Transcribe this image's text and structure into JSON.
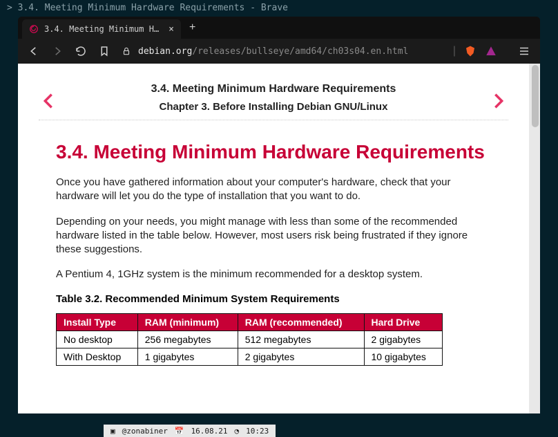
{
  "titlebar": "> 3.4. Meeting Minimum Hardware Requirements - Brave",
  "tab": {
    "title": "3.4. Meeting Minimum Hardw…"
  },
  "url": {
    "host": "debian.org",
    "path": "/releases/bullseye/amd64/ch03s04.en.html"
  },
  "navheader": {
    "section": "3.4. Meeting Minimum Hardware Requirements",
    "chapter": "Chapter 3. Before Installing Debian GNU/Linux"
  },
  "heading": "3.4. Meeting Minimum Hardware Requirements",
  "paragraphs": {
    "p1": "Once you have gathered information about your computer's hardware, check that your hardware will let you do the type of installation that you want to do.",
    "p2": "Depending on your needs, you might manage with less than some of the recommended hardware listed in the table below. However, most users risk being frustrated if they ignore these suggestions.",
    "p3": "A Pentium 4, 1GHz system is the minimum recommended for a desktop system."
  },
  "table": {
    "caption": "Table 3.2. Recommended Minimum System Requirements",
    "headers": [
      "Install Type",
      "RAM (minimum)",
      "RAM (recommended)",
      "Hard Drive"
    ],
    "rows": [
      [
        "No desktop",
        "256 megabytes",
        "512 megabytes",
        "2 gigabytes"
      ],
      [
        "With Desktop",
        "1 gigabytes",
        "2 gigabytes",
        "10 gigabytes"
      ]
    ]
  },
  "statusbar": {
    "user": "@zonabiner",
    "date": "16.08.21",
    "time": "10:23"
  }
}
